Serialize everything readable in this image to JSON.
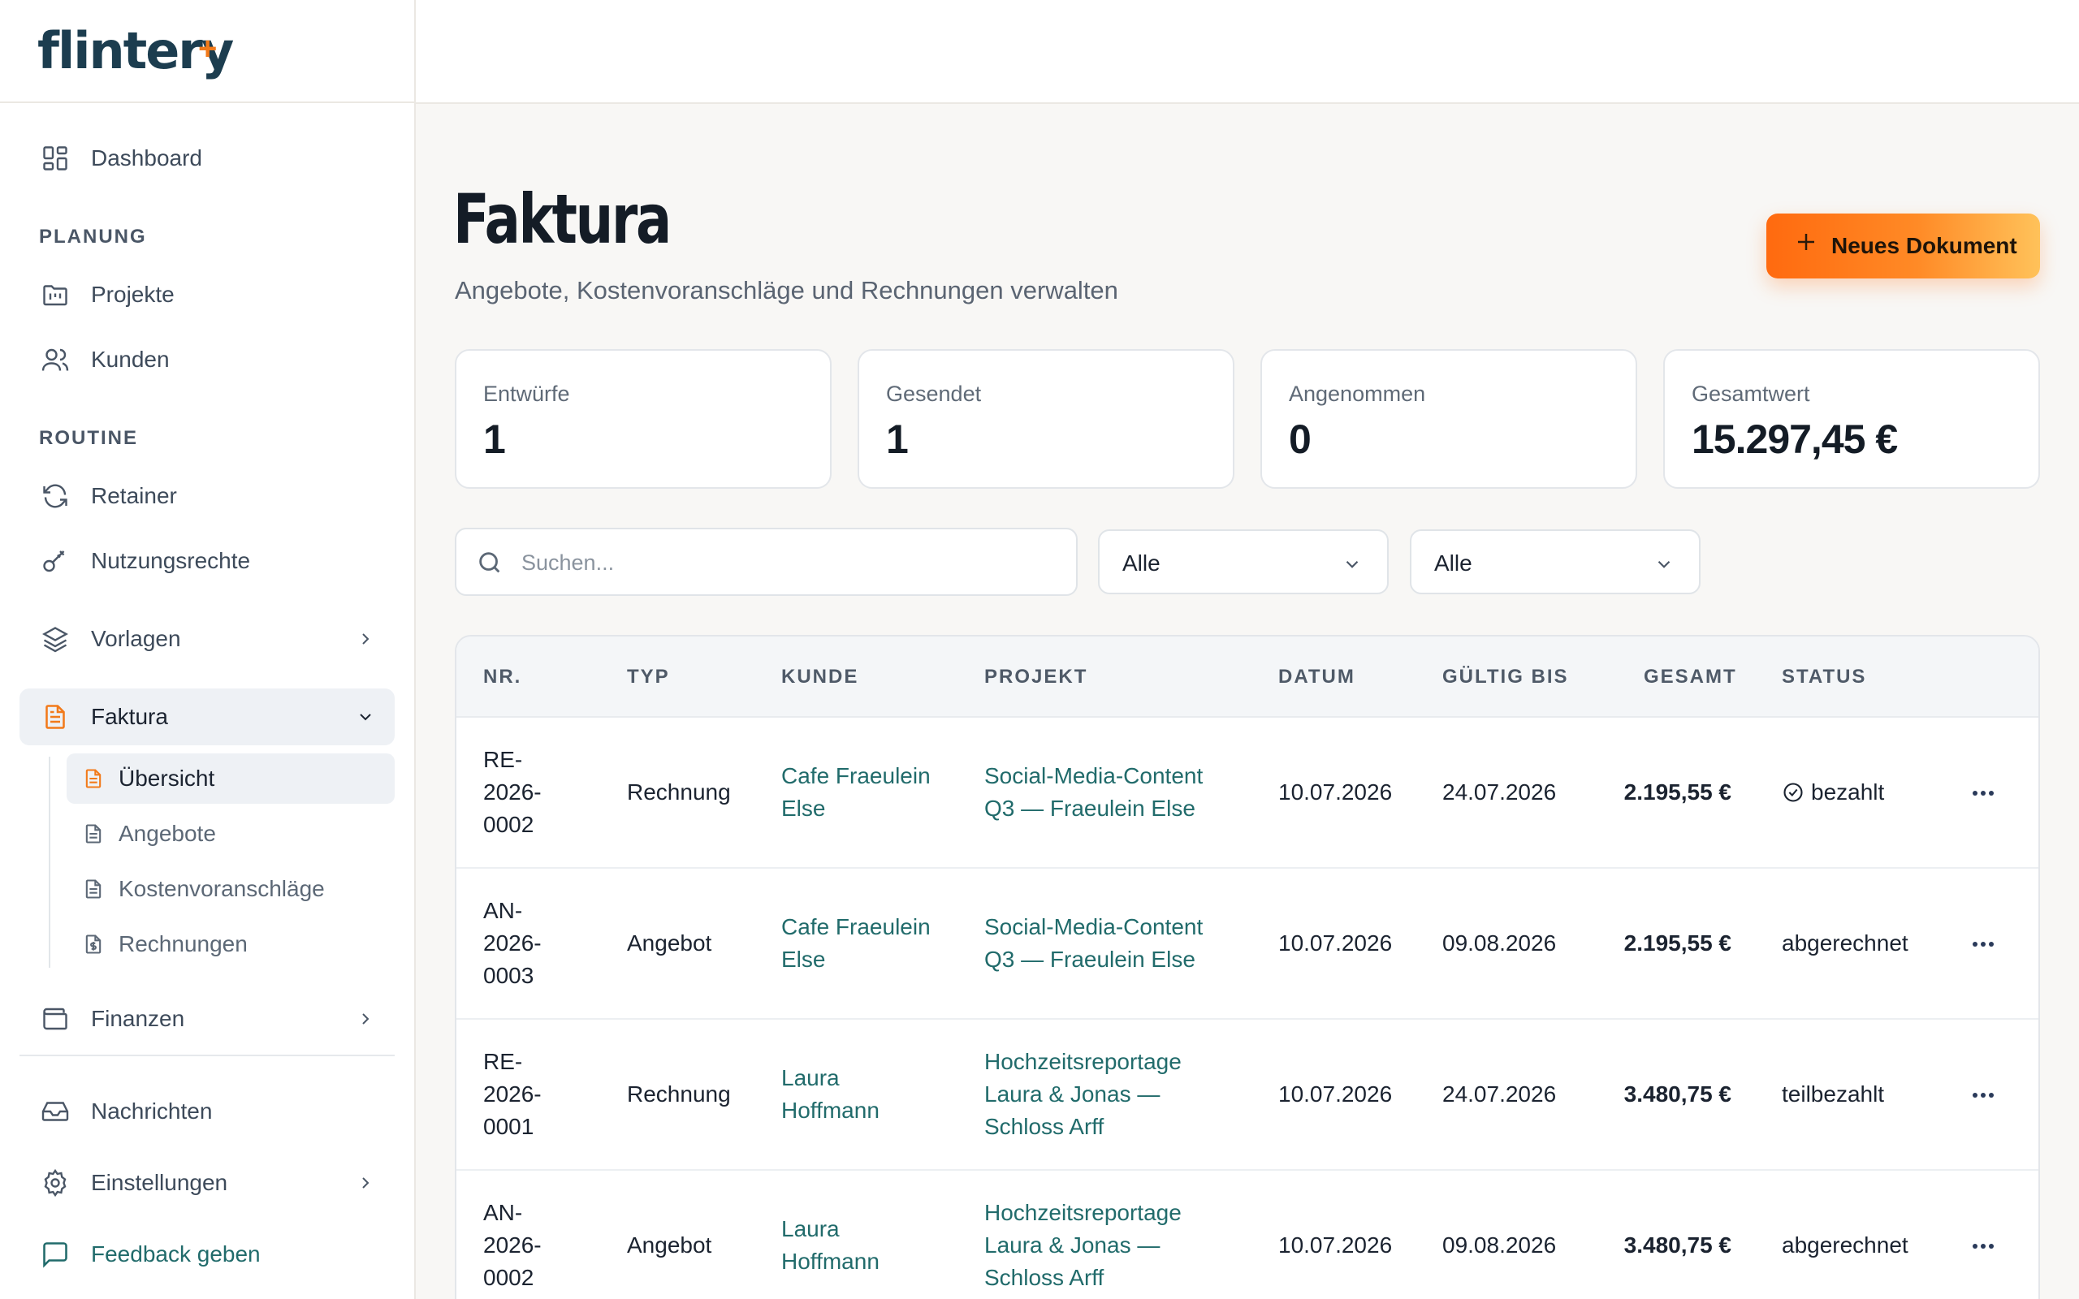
{
  "brand": {
    "name": "flintery",
    "mark": "+"
  },
  "sidebar": {
    "dashboard": "Dashboard",
    "section_planung": "PLANUNG",
    "projekte": "Projekte",
    "kunden": "Kunden",
    "section_routine": "ROUTINE",
    "retainer": "Retainer",
    "nutzungsrechte": "Nutzungsrechte",
    "vorlagen": "Vorlagen",
    "faktura": "Faktura",
    "sub": {
      "uebersicht": "Übersicht",
      "angebote": "Angebote",
      "kostenvoranschlaege": "Kostenvoranschläge",
      "rechnungen": "Rechnungen"
    },
    "finanzen": "Finanzen",
    "nachrichten": "Nachrichten",
    "einstellungen": "Einstellungen",
    "feedback": "Feedback geben"
  },
  "header": {
    "title": "Faktura",
    "subtitle": "Angebote, Kostenvoranschläge und Rechnungen verwalten",
    "new_button": "Neues Dokument"
  },
  "stats": [
    {
      "label": "Entwürfe",
      "value": "1"
    },
    {
      "label": "Gesendet",
      "value": "1"
    },
    {
      "label": "Angenommen",
      "value": "0"
    },
    {
      "label": "Gesamtwert",
      "value": "15.297,45 €"
    }
  ],
  "filters": {
    "search_placeholder": "Suchen...",
    "type_select": "Alle",
    "status_select": "Alle"
  },
  "table": {
    "columns": [
      "NR.",
      "TYP",
      "KUNDE",
      "PROJEKT",
      "DATUM",
      "GÜLTIG BIS",
      "GESAMT",
      "STATUS"
    ],
    "rows": [
      {
        "nr": [
          "RE-",
          "2026-",
          "0002"
        ],
        "typ": "Rechnung",
        "kunde": [
          "Cafe Fraeulein",
          "Else"
        ],
        "projekt": [
          "Social-Media-Content",
          "Q3 — Fraeulein Else"
        ],
        "datum": "10.07.2026",
        "gueltig": "24.07.2026",
        "gesamt": "2.195,55 €",
        "status": "bezahlt"
      },
      {
        "nr": [
          "AN-",
          "2026-",
          "0003"
        ],
        "typ": "Angebot",
        "kunde": [
          "Cafe Fraeulein",
          "Else"
        ],
        "projekt": [
          "Social-Media-Content",
          "Q3 — Fraeulein Else"
        ],
        "datum": "10.07.2026",
        "gueltig": "09.08.2026",
        "gesamt": "2.195,55 €",
        "status": "abgerechnet"
      },
      {
        "nr": [
          "RE-",
          "2026-",
          "0001"
        ],
        "typ": "Rechnung",
        "kunde": [
          "Laura",
          "Hoffmann"
        ],
        "projekt": [
          "Hochzeitsreportage",
          "Laura & Jonas —",
          "Schloss Arff"
        ],
        "datum": "10.07.2026",
        "gueltig": "24.07.2026",
        "gesamt": "3.480,75 €",
        "status": "teilbezahlt"
      },
      {
        "nr": [
          "AN-",
          "2026-",
          "0002"
        ],
        "typ": "Angebot",
        "kunde": [
          "Laura",
          "Hoffmann"
        ],
        "projekt": [
          "Hochzeitsreportage",
          "Laura & Jonas —",
          "Schloss Arff"
        ],
        "datum": "10.07.2026",
        "gueltig": "09.08.2026",
        "gesamt": "3.480,75 €",
        "status": "abgerechnet"
      }
    ]
  },
  "colors": {
    "accent": "#ff7a1a",
    "link": "#216b6b",
    "brand_text": "#1c3d4f"
  }
}
